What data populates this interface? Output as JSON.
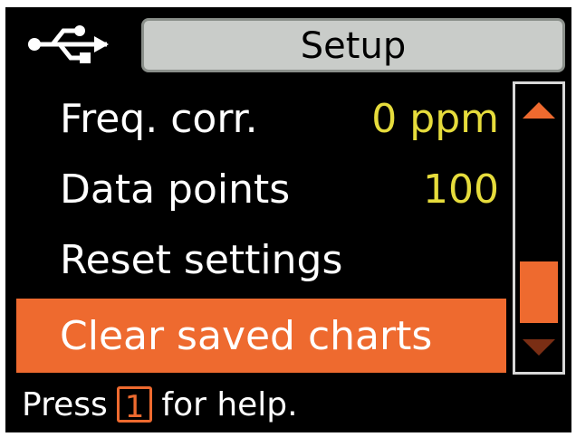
{
  "header": {
    "title": "Setup",
    "connection_icon": "usb-icon"
  },
  "menu": {
    "items": [
      {
        "label": "Freq. corr.",
        "value": "0 ppm",
        "selected": false
      },
      {
        "label": "Data points",
        "value": "100",
        "selected": false
      },
      {
        "label": "Reset settings",
        "value": "",
        "selected": false
      },
      {
        "label": "Clear saved charts",
        "value": "",
        "selected": true
      }
    ]
  },
  "scrollbar": {
    "up_icon": "triangle-up-icon",
    "down_icon": "triangle-down-icon"
  },
  "footer": {
    "help_prefix": "Press",
    "help_key": "1",
    "help_suffix": "for help."
  },
  "colors": {
    "accent": "#ee6a2f",
    "value": "#e6dc3c",
    "title_bg": "#c9ccc9",
    "screen_bg": "#000000"
  }
}
